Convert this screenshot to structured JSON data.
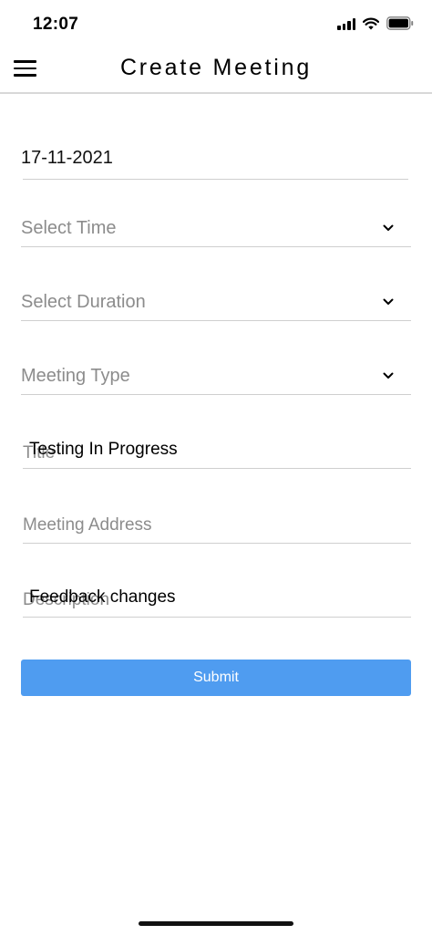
{
  "status_bar": {
    "time": "12:07",
    "icons": [
      "signal-icon",
      "wifi-icon",
      "battery-icon"
    ]
  },
  "header": {
    "title": "Create Meeting",
    "menu_icon": "hamburger-menu-icon"
  },
  "form": {
    "date": {
      "value": "17-11-2021"
    },
    "time": {
      "placeholder": "Select Time"
    },
    "duration": {
      "placeholder": "Select Duration"
    },
    "meeting_type": {
      "placeholder": "Meeting Type"
    },
    "title": {
      "label": "Title",
      "value": "Testing In Progress"
    },
    "address": {
      "placeholder": "Meeting Address"
    },
    "description": {
      "label": "Description",
      "value": "Feedback changes"
    }
  },
  "submit": {
    "label": "Submit"
  },
  "colors": {
    "accent": "#4f9cf0",
    "placeholder": "#8c8c8c",
    "divider": "#cfcfcf"
  }
}
